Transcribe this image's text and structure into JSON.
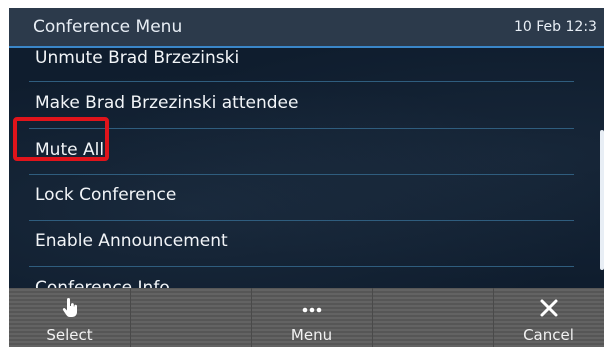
{
  "header": {
    "title": "Conference Menu",
    "datetime": "10 Feb 12:3"
  },
  "menu": {
    "items": [
      {
        "label": "Unmute Brad Brzezinski"
      },
      {
        "label": "Make Brad Brzezinski attendee"
      },
      {
        "label": "Mute All",
        "highlighted": true
      },
      {
        "label": "Lock Conference"
      },
      {
        "label": "Enable Announcement"
      },
      {
        "label": "Conference Info"
      }
    ]
  },
  "softkeys": [
    {
      "label": "Select",
      "icon": "hand-pointer-icon"
    },
    {
      "label": "",
      "icon": ""
    },
    {
      "label": "Menu",
      "icon": "more-dots-icon"
    },
    {
      "label": "",
      "icon": ""
    },
    {
      "label": "Cancel",
      "icon": "close-icon"
    }
  ],
  "colors": {
    "background": "#0f1d2e",
    "header": "#2c3a4b",
    "accent": "#3a86c8",
    "highlight": "#e0141b",
    "softkey_bar": "#5b5b5b"
  }
}
